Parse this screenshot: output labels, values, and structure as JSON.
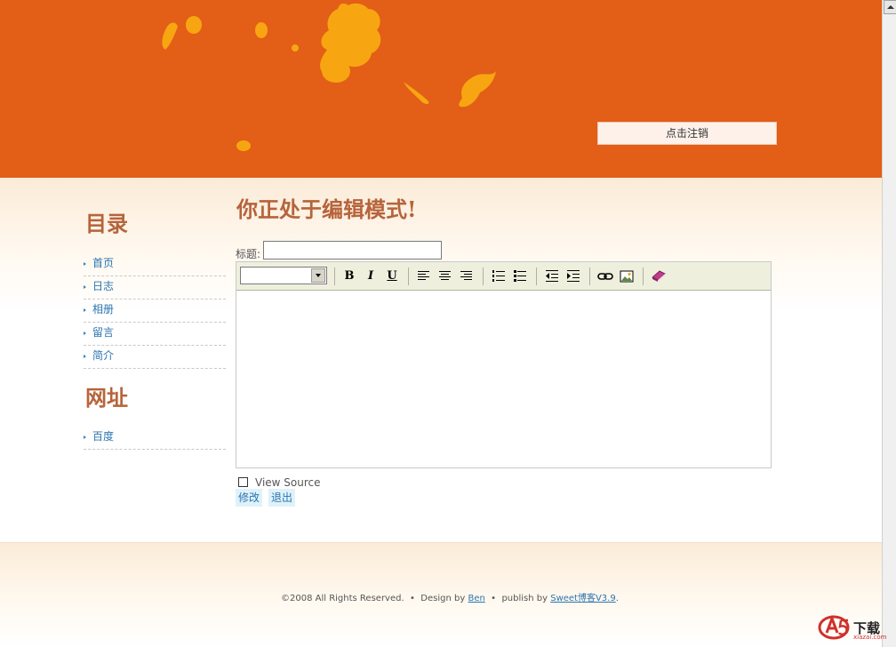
{
  "header": {
    "logout_label": "点击注销",
    "bg_color": "#E35E17",
    "splash_color": "#F7A612"
  },
  "sidebar": {
    "catalog_title": "目录",
    "catalog_items": [
      {
        "label": "首页"
      },
      {
        "label": "日志"
      },
      {
        "label": "相册"
      },
      {
        "label": "留言"
      },
      {
        "label": "简介"
      }
    ],
    "links_title": "网址",
    "link_items": [
      {
        "label": "百度"
      }
    ]
  },
  "main": {
    "heading": "你正处于编辑模式!",
    "title_label": "标题:",
    "title_value": "",
    "view_source_label": "View Source",
    "view_source_checked": false,
    "save_label": "修改",
    "exit_label": "退出"
  },
  "editor": {
    "font_select_value": "",
    "toolbar_icons": [
      "bold-icon",
      "italic-icon",
      "underline-icon",
      "align-left-icon",
      "align-center-icon",
      "align-right-icon",
      "ordered-list-icon",
      "unordered-list-icon",
      "outdent-icon",
      "indent-icon",
      "link-icon",
      "image-icon",
      "book-icon"
    ],
    "bold_glyph": "B",
    "italic_glyph": "I",
    "underline_glyph": "U"
  },
  "footer": {
    "copyright": "©2008 All Rights Reserved.",
    "sep": "•",
    "design_by": "Design by",
    "designer": "Ben",
    "publish_by": "publish by",
    "engine": "Sweet博客V3.9",
    "end": "."
  },
  "watermark": {
    "text": "下载",
    "sub": "xiazai.com"
  },
  "colors": {
    "accent_brown": "#B6643B",
    "link_blue": "#2B75B0"
  }
}
